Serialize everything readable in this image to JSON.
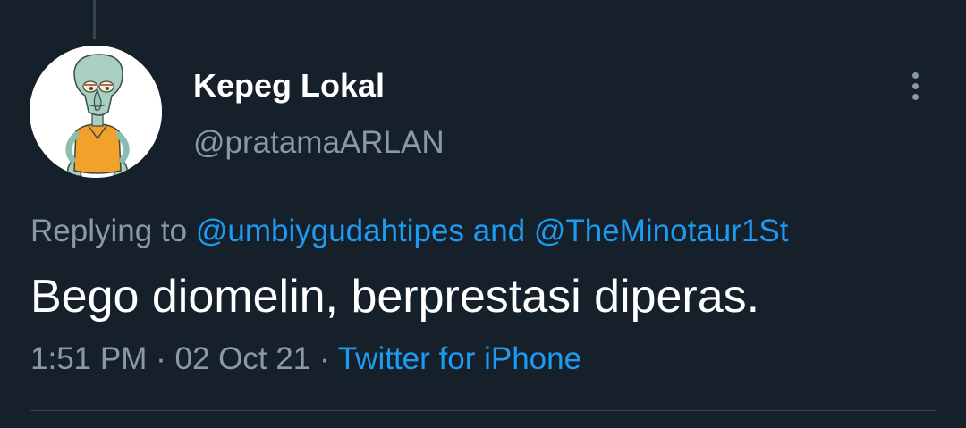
{
  "tweet": {
    "display_name": "Kepeg Lokal",
    "handle": "@pratamaARLAN",
    "avatar_icon": "squidward-avatar",
    "more_icon": "more-vertical-icon",
    "replying_label": "Replying to",
    "reply_target_1": "@umbiygudahtipes",
    "and_label": "and",
    "reply_target_2": "@TheMinotaur1St",
    "text": "Bego diomelin, berprestasi diperas.",
    "time": "1:51 PM",
    "separator": "·",
    "date": "02 Oct 21",
    "source": "Twitter for iPhone"
  },
  "colors": {
    "background": "#15202b",
    "primary_text": "#ffffff",
    "secondary_text": "#8b98a5",
    "link": "#1d9bf0",
    "divider": "#38444d"
  }
}
